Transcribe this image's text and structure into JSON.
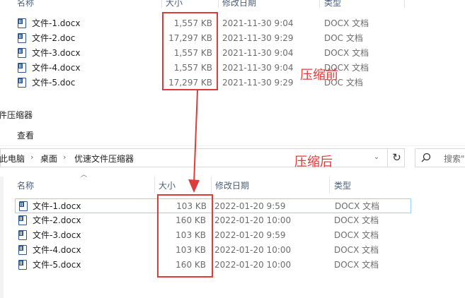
{
  "top": {
    "headers": {
      "name": "名称",
      "size": "大小",
      "date": "修改日期",
      "type": "类型"
    },
    "files": [
      {
        "name": "文件-1.docx",
        "size": "1,557 KB",
        "date": "2021-11-30 9:04",
        "type": "DOCX 文档"
      },
      {
        "name": "文件-2.doc",
        "size": "17,297 KB",
        "date": "2021-11-30 9:29",
        "type": "DOC 文档"
      },
      {
        "name": "文件-3.docx",
        "size": "1,557 KB",
        "date": "2021-11-30 9:04",
        "type": "DOCX 文档"
      },
      {
        "name": "文件-4.docx",
        "size": "1,557 KB",
        "date": "2021-11-30 9:04",
        "type": "DOCX 文档"
      },
      {
        "name": "文件-5.doc",
        "size": "17,297 KB",
        "date": "2021-11-30 9:29",
        "type": "DOC 文档"
      }
    ],
    "annotation": "压缩前"
  },
  "bottom": {
    "title": "件压缩器",
    "ribbon_tab": "查看",
    "breadcrumb": [
      "此电脑",
      "桌面",
      "优速文件压缩器"
    ],
    "search_placeholder": "搜索\"",
    "headers": {
      "name": "名称",
      "size": "大小",
      "date": "修改日期",
      "type": "类型"
    },
    "files": [
      {
        "name": "文件-1.docx",
        "size": "103 KB",
        "date": "2022-01-20 9:59",
        "type": "DOCX 文档"
      },
      {
        "name": "文件-2.docx",
        "size": "160 KB",
        "date": "2022-01-20 10:00",
        "type": "DOCX 文档"
      },
      {
        "name": "文件-3.docx",
        "size": "103 KB",
        "date": "2022-01-20 9:59",
        "type": "DOCX 文档"
      },
      {
        "name": "文件-4.docx",
        "size": "103 KB",
        "date": "2022-01-20 10:00",
        "type": "DOCX 文档"
      },
      {
        "name": "文件-5.docx",
        "size": "160 KB",
        "date": "2022-01-20 10:00",
        "type": "DOCX 文档"
      }
    ],
    "annotation": "压缩后"
  },
  "colors": {
    "annotation_red": "#e03b3b",
    "word_blue": "#2b579a",
    "selection_border": "#99d1ff"
  },
  "icons": {
    "file": "word-doc-icon",
    "refresh": "refresh-icon",
    "search": "search-icon",
    "dropdown": "chevron-down-icon"
  }
}
